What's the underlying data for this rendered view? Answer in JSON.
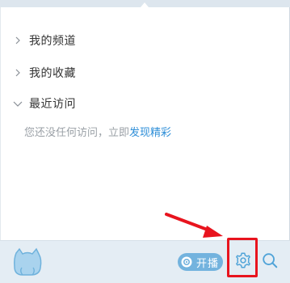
{
  "menu": {
    "items": [
      {
        "label": "我的频道",
        "expanded": false
      },
      {
        "label": "我的收藏",
        "expanded": false
      },
      {
        "label": "最近访问",
        "expanded": true
      }
    ],
    "recent_empty": {
      "text": "您还没任何访问，立即",
      "link": "发现精彩"
    }
  },
  "bottom": {
    "live_button": "开播",
    "settings_icon": "gear-icon",
    "search_icon": "search-icon",
    "logo_icon": "cat-mascot-icon"
  },
  "colors": {
    "accent": "#2f8fd8",
    "bottom_bar": "#e4edf4",
    "live_button": "#73b3de",
    "annotation_red": "#e8141e"
  }
}
